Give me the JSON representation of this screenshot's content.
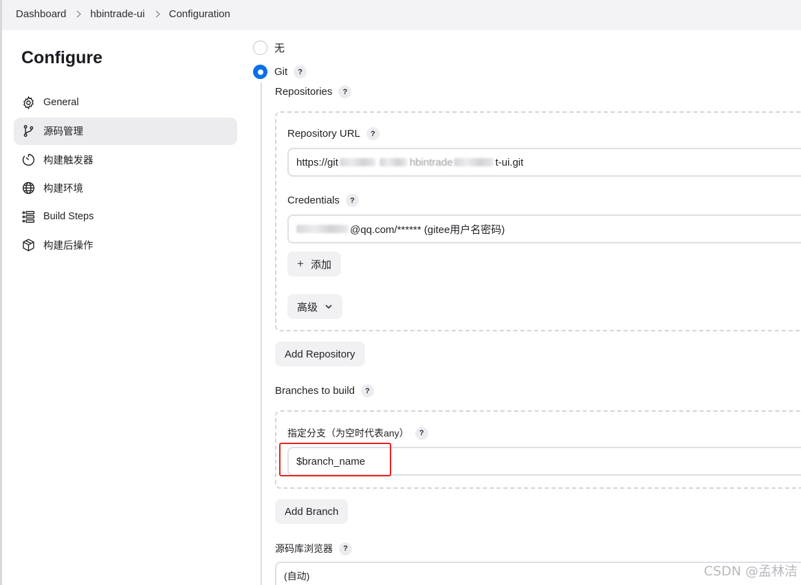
{
  "breadcrumb": [
    "Dashboard",
    "hbintrade-ui",
    "Configuration"
  ],
  "sidebar": {
    "title": "Configure",
    "items": [
      {
        "label": "General",
        "icon": "gear-icon",
        "active": false
      },
      {
        "label": "源码管理",
        "icon": "branch-icon",
        "active": true
      },
      {
        "label": "构建触发器",
        "icon": "timer-icon",
        "active": false
      },
      {
        "label": "构建环境",
        "icon": "globe-icon",
        "active": false
      },
      {
        "label": "Build Steps",
        "icon": "list-icon",
        "active": false
      },
      {
        "label": "构建后操作",
        "icon": "package-icon",
        "active": false
      }
    ]
  },
  "scm": {
    "option_none": "无",
    "option_git": "Git",
    "selected": "Git",
    "repositories_label": "Repositories",
    "repo_url_label": "Repository URL",
    "repo_url_prefix": "https://git",
    "repo_url_middle": "hbintrade",
    "repo_url_suffix": "t-ui.git",
    "credentials_label": "Credentials",
    "credentials_value": "@qq.com/****** (gitee用户名密码)",
    "add_button": "添加",
    "advanced_button": "高级",
    "add_repository_button": "Add Repository",
    "branches_label": "Branches to build",
    "branch_specifier_label": "指定分支（为空时代表any）",
    "branch_specifier_value": "$branch_name",
    "add_branch_button": "Add Branch",
    "browser_label": "源码库浏览器",
    "browser_value": "(自动)"
  },
  "help_glyph": "?",
  "watermark": "CSDN @孟林洁",
  "colors": {
    "accent": "#0b6fe6",
    "highlight": "#e6231f"
  }
}
